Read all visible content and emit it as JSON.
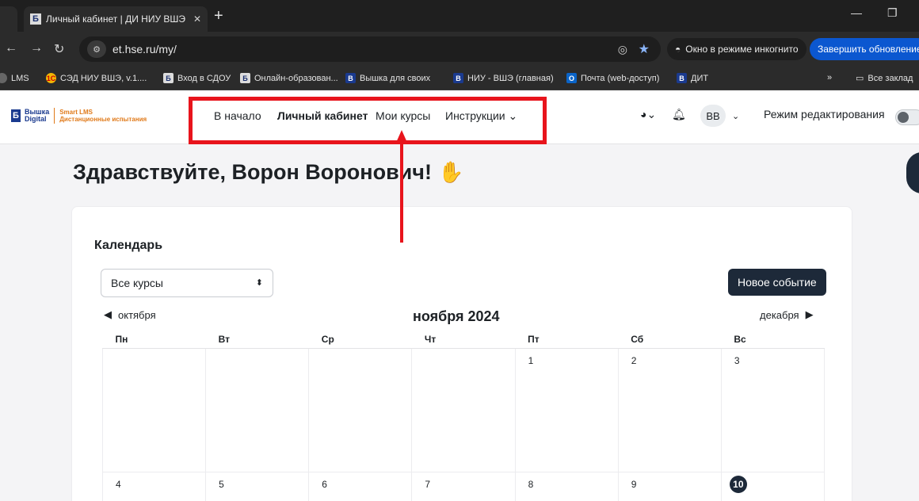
{
  "browser": {
    "tab_title": "Личный кабинет | ДИ НИУ ВШЭ",
    "tab_close": "✕",
    "new_tab": "+",
    "url": "et.hse.ru/my/",
    "incognito_label": "Окно в режиме инкогнито",
    "update_button": "Завершить обновление",
    "bookmarks": [
      {
        "label": "LMS",
        "icon": "lms-icon"
      },
      {
        "label": "СЭД НИУ ВШЭ, v.1....",
        "icon": "sed-icon"
      },
      {
        "label": "Вход в СДОУ",
        "icon": "hse-icon"
      },
      {
        "label": "Онлайн-образован...",
        "icon": "hse-icon"
      },
      {
        "label": "Вышка для своих",
        "icon": "hse-blue-icon"
      },
      {
        "label": "НИУ - ВШЭ (главная)",
        "icon": "hse-blue-icon"
      },
      {
        "label": "Почта (web-доступ)",
        "icon": "outlook-icon"
      },
      {
        "label": "ДИТ",
        "icon": "hse-blue-icon"
      }
    ],
    "bookmarks_overflow": "»",
    "all_bookmarks": "Все заклад"
  },
  "site": {
    "logo_line1": "Вышка",
    "logo_line2": "Digital",
    "logo_line3": "Smart LMS",
    "logo_line4": "Дистанционные испытания",
    "nav": [
      {
        "label": "В начало"
      },
      {
        "label": "Личный кабинет"
      },
      {
        "label": "Мои курсы"
      },
      {
        "label": "Инструкции ⌄"
      }
    ],
    "avatar_initials": "ВВ",
    "edit_mode_label": "Режим редактирования"
  },
  "main": {
    "greeting": "Здравствуйте, Ворон Воронович!",
    "calendar_title": "Календарь",
    "course_filter": "Все курсы",
    "new_event": "Новое событие",
    "prev_month": "октября",
    "current_month": "ноября 2024",
    "next_month": "декабря",
    "weekdays": [
      "Пн",
      "Вт",
      "Ср",
      "Чт",
      "Пт",
      "Сб",
      "Вс"
    ],
    "week1": [
      "",
      "",
      "",
      "",
      "1",
      "2",
      "3"
    ],
    "week2": [
      "4",
      "5",
      "6",
      "7",
      "8",
      "9",
      "10"
    ],
    "today": "10"
  },
  "colors": {
    "highlight": "#e8141c",
    "primary": "#1d2939",
    "brand_blue": "#1a3a8f",
    "brand_orange": "#e07a1a"
  }
}
